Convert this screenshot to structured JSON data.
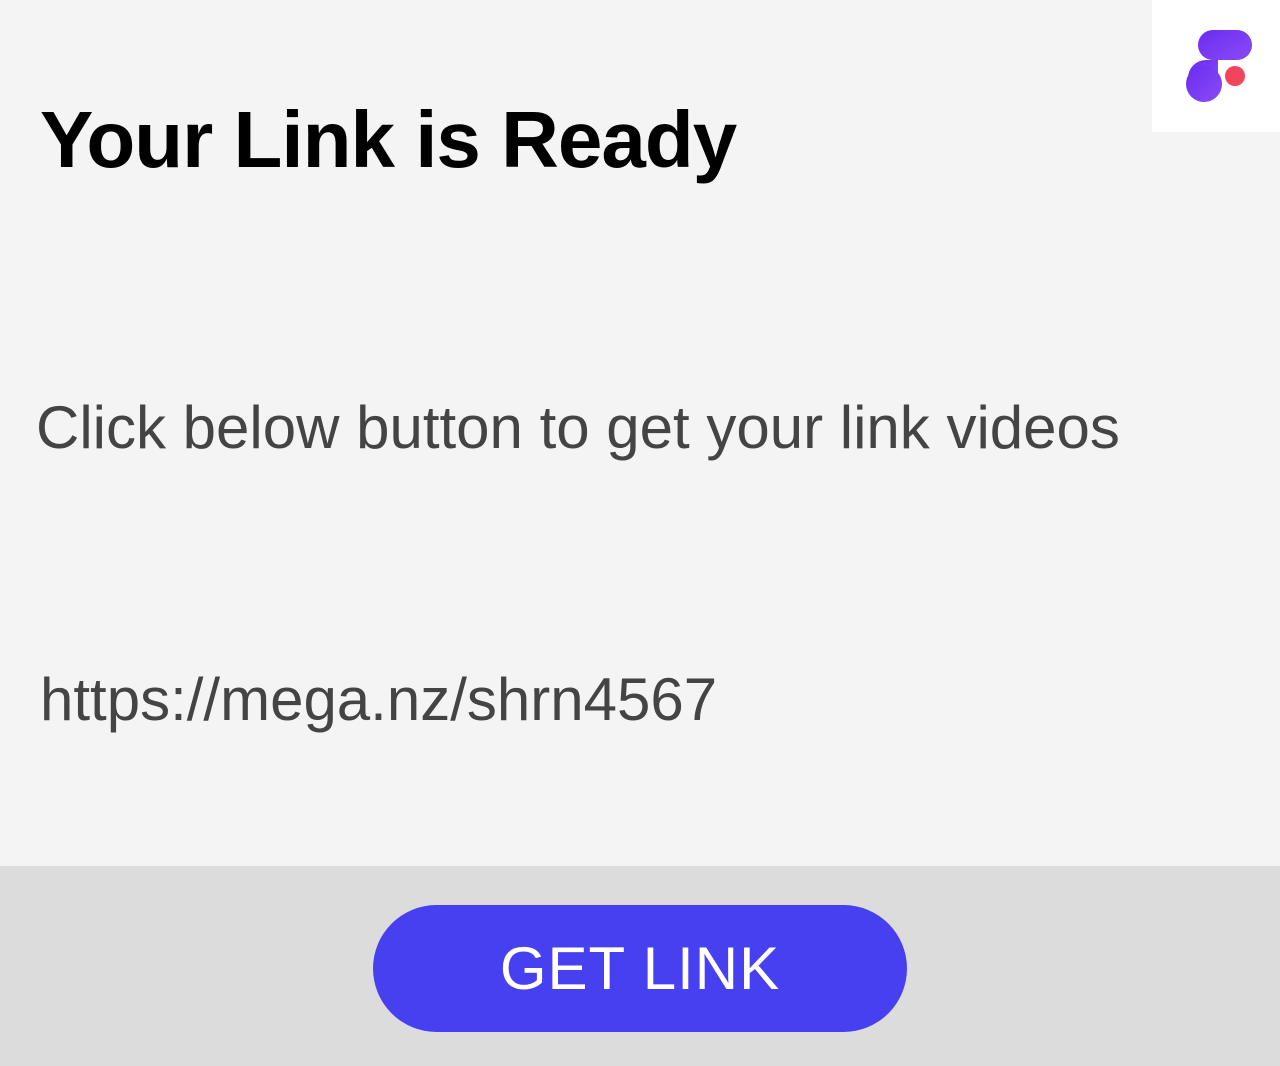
{
  "header": {
    "title": "Your Link is Ready",
    "logo_icon": "app-logo-icon",
    "logo_colors": {
      "gradient_start": "#6a2cf0",
      "gradient_end": "#8a4cf5",
      "dot": "#f2445a"
    }
  },
  "content": {
    "instruction": "Click below button to get your link videos",
    "link_url": "https://mega.nz/shrn4567"
  },
  "footer": {
    "button_label": "GET LINK",
    "button_color": "#4740f0",
    "bar_color": "#dcdcdc"
  }
}
